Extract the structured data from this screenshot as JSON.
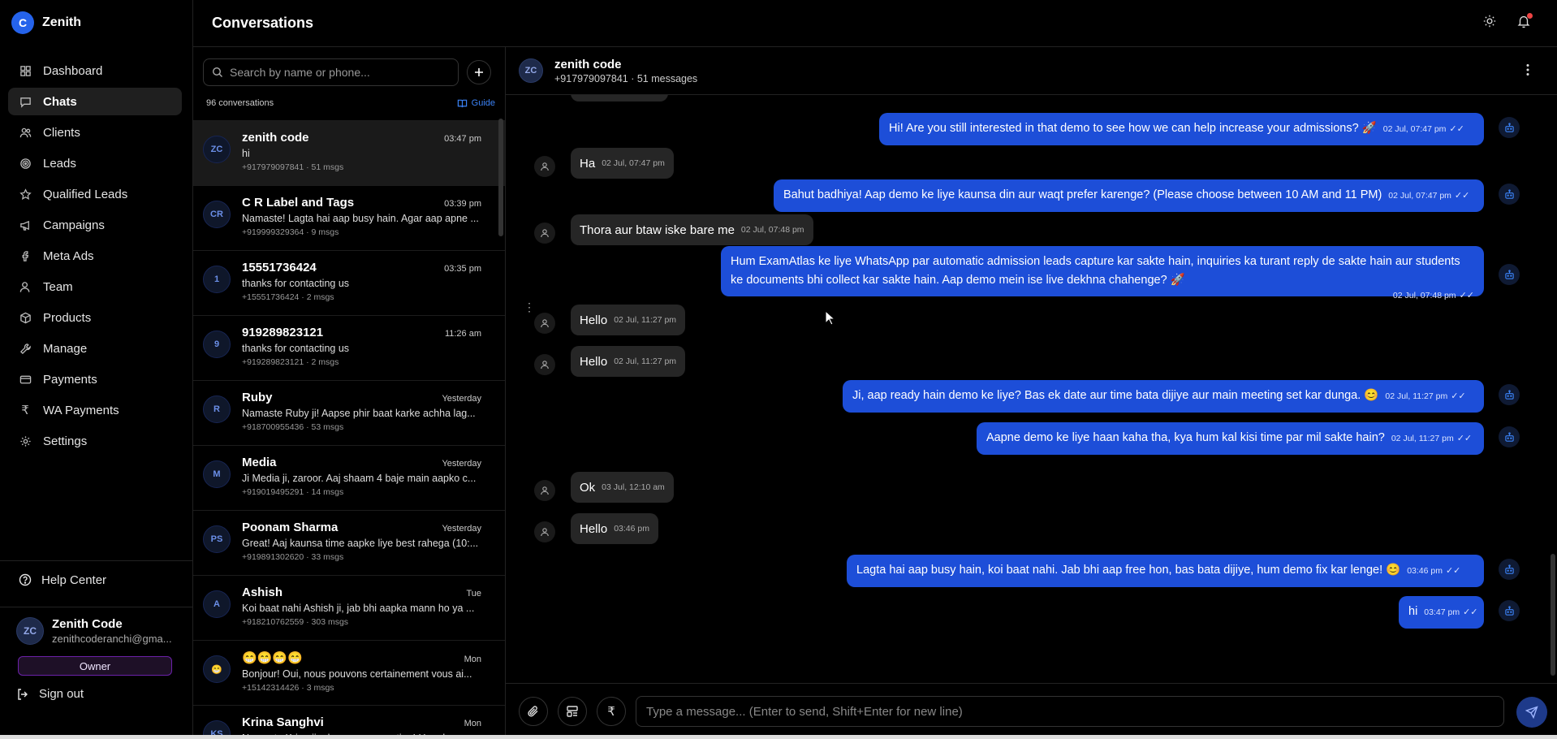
{
  "brand": {
    "logo_letter": "C",
    "name": "Zenith"
  },
  "sidebar": {
    "items": [
      {
        "label": "Dashboard",
        "icon": "grid-icon"
      },
      {
        "label": "Chats",
        "icon": "chat-icon"
      },
      {
        "label": "Clients",
        "icon": "users-icon"
      },
      {
        "label": "Leads",
        "icon": "target-icon"
      },
      {
        "label": "Qualified Leads",
        "icon": "star-icon"
      },
      {
        "label": "Campaigns",
        "icon": "megaphone-icon"
      },
      {
        "label": "Meta Ads",
        "icon": "facebook-icon"
      },
      {
        "label": "Team",
        "icon": "user-icon"
      },
      {
        "label": "Products",
        "icon": "box-icon"
      },
      {
        "label": "Manage",
        "icon": "wrench-icon"
      },
      {
        "label": "Payments",
        "icon": "card-icon"
      },
      {
        "label": "WA Payments",
        "icon": "rupee-icon"
      },
      {
        "label": "Settings",
        "icon": "gear-icon"
      }
    ],
    "active": "Chats",
    "help_label": "Help Center",
    "user": {
      "initials": "ZC",
      "name": "Zenith Code",
      "email": "zenithcoderanchi@gma...",
      "role": "Owner"
    },
    "signout_label": "Sign out"
  },
  "header": {
    "title": "Conversations"
  },
  "convlist": {
    "search_placeholder": "Search by name or phone...",
    "count_label": "96 conversations",
    "guide_label": "Guide",
    "items": [
      {
        "initials": "ZC",
        "name": "zenith code",
        "time": "03:47 pm",
        "message": "hi",
        "sub": "+917979097841 · 51 msgs"
      },
      {
        "initials": "CR",
        "name": "C R Label and Tags",
        "time": "03:39 pm",
        "message": "Namaste! Lagta hai aap busy hain. Agar aap apne ...",
        "sub": "+919999329364 · 9 msgs"
      },
      {
        "initials": "1",
        "name": "15551736424",
        "time": "03:35 pm",
        "message": "thanks for contacting us",
        "sub": "+15551736424 · 2 msgs"
      },
      {
        "initials": "9",
        "name": "919289823121",
        "time": "11:26 am",
        "message": "thanks for contacting us",
        "sub": "+919289823121 · 2 msgs"
      },
      {
        "initials": "R",
        "name": "Ruby",
        "time": "Yesterday",
        "message": "Namaste Ruby ji! Aapse phir baat karke achha lag...",
        "sub": "+918700955436 · 53 msgs"
      },
      {
        "initials": "M",
        "name": "Media",
        "time": "Yesterday",
        "message": "Ji Media ji, zaroor. Aaj shaam 4 baje main aapko c...",
        "sub": "+919019495291 · 14 msgs"
      },
      {
        "initials": "PS",
        "name": "Poonam Sharma",
        "time": "Yesterday",
        "message": "Great! Aaj kaunsa time aapke liye best rahega (10:...",
        "sub": "+919891302620 · 33 msgs"
      },
      {
        "initials": "A",
        "name": "Ashish",
        "time": "Tue",
        "message": "Koi baat nahi Ashish ji, jab bhi aapka mann ho ya ...",
        "sub": "+918210762559 · 303 msgs"
      },
      {
        "initials": "😁",
        "name": "😁😁😁😁",
        "time": "Mon",
        "message": "Bonjour! Oui, nous pouvons certainement vous ai...",
        "sub": "+15142314426 · 3 msgs"
      },
      {
        "initials": "KS",
        "name": "Krina Sanghvi",
        "time": "Mon",
        "message": "Namaste Krina ji, pleasure connecting! Hum log a...",
        "sub": ""
      }
    ]
  },
  "chat": {
    "initials": "ZC",
    "name": "zenith code",
    "sub": "+917979097841 · 51 messages",
    "messages": [
      {
        "dir": "out",
        "text": "Hi! Are you still interested in that demo to see how we can help increase your admissions? 🚀",
        "time": "02 Jul, 07:47 pm"
      },
      {
        "dir": "in",
        "text": "Ha",
        "time": "02 Jul, 07:47 pm"
      },
      {
        "dir": "out",
        "text": "Bahut badhiya! Aap demo ke liye kaunsa din aur waqt prefer karenge? (Please choose between 10 AM and 11 PM)",
        "time": "02 Jul, 07:47 pm"
      },
      {
        "dir": "in",
        "text": "Thora aur btaw iske bare me",
        "time": "02 Jul, 07:48 pm"
      },
      {
        "dir": "out",
        "text": "Hum ExamAtlas ke liye WhatsApp par automatic admission leads capture kar sakte hain, inquiries ka turant reply de sakte hain aur students ke documents bhi collect kar sakte hain. Aap demo mein ise live dekhna chahenge? 🚀",
        "time": "02 Jul, 07:48 pm"
      },
      {
        "dir": "in",
        "text": "Hello",
        "time": "02 Jul, 11:27 pm"
      },
      {
        "dir": "in",
        "text": "Hello",
        "time": "02 Jul, 11:27 pm"
      },
      {
        "dir": "out",
        "text": "Ji, aap ready hain demo ke liye? Bas ek date aur time bata dijiye aur main meeting set kar dunga. 😊",
        "time": "02 Jul, 11:27 pm"
      },
      {
        "dir": "out",
        "text": "Aapne demo ke liye haan kaha tha, kya hum kal kisi time par mil sakte hain?",
        "time": "02 Jul, 11:27 pm"
      },
      {
        "dir": "in",
        "text": "Ok",
        "time": "03 Jul, 12:10 am"
      },
      {
        "dir": "in",
        "text": "Hello",
        "time": "03:46 pm"
      },
      {
        "dir": "out",
        "text": "Lagta hai aap busy hain, koi baat nahi. Jab bhi aap free hon, bas bata dijiye, hum demo fix kar lenge! 😊",
        "time": "03:46 pm"
      },
      {
        "dir": "out",
        "text": "hi",
        "time": "03:47 pm"
      }
    ],
    "composer_placeholder": "Type a message... (Enter to send, Shift+Enter for new line)"
  },
  "colors": {
    "accent": "#1d4ed8",
    "owner_border": "#6b21a8",
    "notification": "#ef4444"
  }
}
